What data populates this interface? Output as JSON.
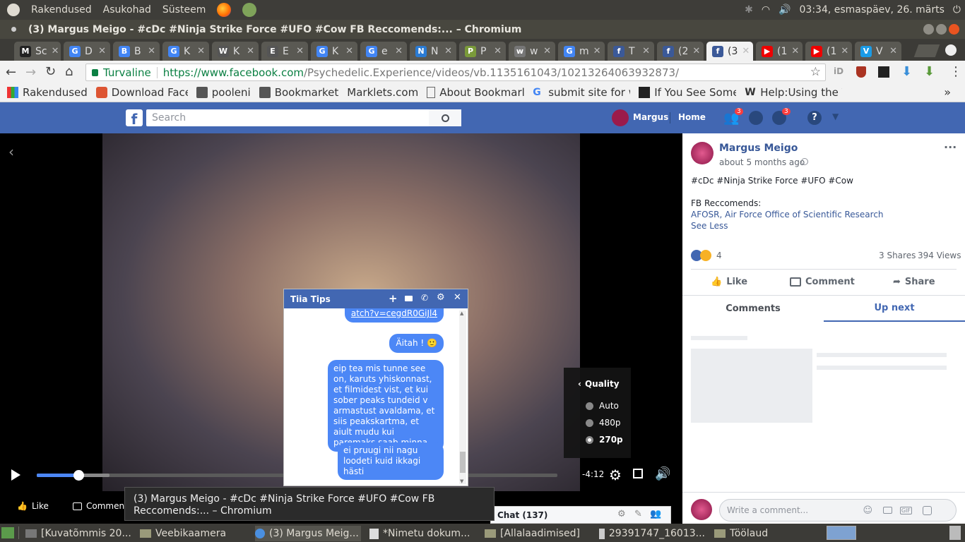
{
  "top_panel": {
    "menus": [
      "Rakendused",
      "Asukohad",
      "Süsteem"
    ],
    "clock": "03:34, esmaspäev, 26. märts"
  },
  "window": {
    "title": "(3) Margus Meigo - #cDc #Ninja Strike Force #UFO #Cow FB Reccomends:... – Chromium"
  },
  "tabs": [
    {
      "letter": "M",
      "label": "Sc",
      "color": "#222222"
    },
    {
      "letter": "G",
      "label": "D",
      "color": "#4285f4"
    },
    {
      "letter": "B",
      "label": "B",
      "color": "#4285f4"
    },
    {
      "letter": "G",
      "label": "K",
      "color": "#4285f4"
    },
    {
      "letter": "W",
      "label": "K",
      "color": "#555555"
    },
    {
      "letter": "E",
      "label": "E",
      "color": "#555555"
    },
    {
      "letter": "G",
      "label": "K",
      "color": "#4285f4"
    },
    {
      "letter": "G",
      "label": "e",
      "color": "#4285f4"
    },
    {
      "letter": "N",
      "label": "N",
      "color": "#2a7bd4"
    },
    {
      "letter": "P",
      "label": "P",
      "color": "#7a9a3a"
    },
    {
      "letter": "w",
      "label": "w",
      "color": "#777777"
    },
    {
      "letter": "G",
      "label": "m",
      "color": "#4285f4"
    },
    {
      "letter": "f",
      "label": "T",
      "color": "#3b5998"
    },
    {
      "letter": "f",
      "label": "(2",
      "color": "#3b5998"
    },
    {
      "letter": "f",
      "label": "(3",
      "color": "#3b5998"
    },
    {
      "letter": "▶",
      "label": "(1",
      "color": "#ee0000"
    },
    {
      "letter": "▶",
      "label": "(1",
      "color": "#ee0000"
    },
    {
      "letter": "V",
      "label": "V",
      "color": "#1a9be6"
    }
  ],
  "address": {
    "secure_label": "Turvaline",
    "url_prefix": "https://www.facebook.com",
    "url_path": "/Psychedelic.Experience/videos/vb.1135161043/10213264063932873/"
  },
  "bookmarks": [
    {
      "label": "Rakendused"
    },
    {
      "label": "Download Faceb"
    },
    {
      "label": "pooleni"
    },
    {
      "label": "Bookmarket"
    },
    {
      "label": "Marklets.com"
    },
    {
      "label": "About Bookmarl"
    },
    {
      "label": "submit site for w"
    },
    {
      "label": "If You See Somet"
    },
    {
      "label": "Help:Using the V"
    }
  ],
  "fb_header": {
    "search_placeholder": "Search",
    "user_name": "Margus",
    "home_label": "Home",
    "friends_badge": "3",
    "notif_badge": "3"
  },
  "video": {
    "time_remaining": "-4:12",
    "progress": 0.08,
    "buffered": 0.14,
    "like_label": "Like",
    "comment_label": "Comment"
  },
  "quality_menu": {
    "title": "Quality",
    "options": [
      {
        "label": "Auto",
        "selected": false
      },
      {
        "label": "480p",
        "selected": false
      },
      {
        "label": "270p",
        "selected": true
      }
    ]
  },
  "chat": {
    "name": "Tiia Tips",
    "link_partial": "atch?v=cegdR0GiJl4",
    "messages": [
      "Äitah ! 🙂",
      "eip tea mis tunne see on, karuts yhiskonnast, et filmidest vist, et kui sober peaks tundeid v armastust avaldama, et siis peakskartma, et aiult mudu kui paremaks saab minna",
      "ei pruugi nii nagu loodeti kuid ikkagi hästi"
    ],
    "chat_label": "Chat (137)"
  },
  "post": {
    "author": "Margus Meigo",
    "time": "about 5 months ago",
    "line1": "#cDc #Ninja Strike Force #UFO #Cow",
    "line2": "FB Reccomends:",
    "link": "AFOSR, Air Force Office of Scientific Research",
    "see_less": "See Less",
    "reaction_count": "4",
    "shares": "3 Shares",
    "views": "394 Views",
    "actions": {
      "like": "Like",
      "comment": "Comment",
      "share": "Share"
    },
    "tabs": {
      "comments": "Comments",
      "up_next": "Up next"
    },
    "comment_placeholder": "Write a comment..."
  },
  "tooltip": {
    "text": "(3) Margus Meigo - #cDc #Ninja Strike Force #UFO #Cow FB Reccomends:... – Chromium"
  },
  "taskbar": {
    "items": [
      {
        "label": "[Kuvatõmmis 20..."
      },
      {
        "label": "Veebikaamera"
      },
      {
        "label": "(3) Margus Meig..."
      },
      {
        "label": "*Nimetu dokum..."
      },
      {
        "label": "[Allalaadimised]"
      },
      {
        "label": "29391747_16013..."
      },
      {
        "label": "Töölaud"
      }
    ]
  }
}
